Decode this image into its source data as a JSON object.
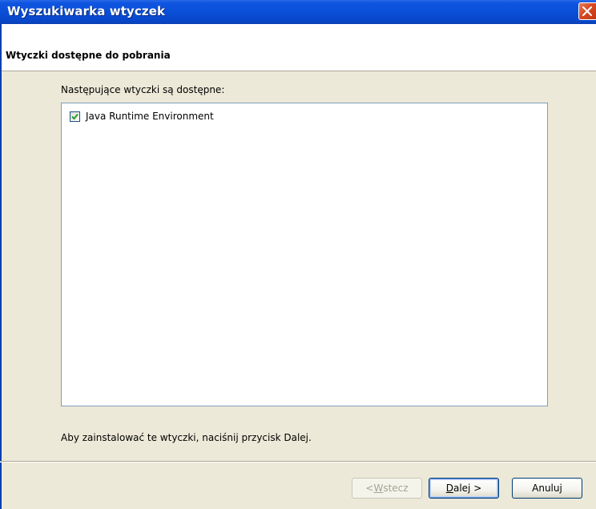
{
  "window": {
    "title": "Wyszukiwarka wtyczek"
  },
  "header": {
    "title": "Wtyczki dostępne do pobrania"
  },
  "content": {
    "intro_label": "Następujące wtyczki są dostępne:",
    "plugins": [
      {
        "label": "Java Runtime Environment",
        "checked": true
      }
    ],
    "footer_text": "Aby zainstalować te wtyczki, naciśnij przycisk Dalej."
  },
  "buttons": {
    "back": {
      "mnemonic": "W",
      "rest": "stecz",
      "prefix": "< ",
      "enabled": false
    },
    "next": {
      "mnemonic": "D",
      "rest": "alej >",
      "enabled": true,
      "default": true
    },
    "cancel": {
      "label": "Anuluj",
      "enabled": true
    }
  },
  "colors": {
    "titlebar": "#0a4fd8",
    "close_button": "#d84a24",
    "dialog_bg": "#ece9d8",
    "listbox_border": "#7f9db9"
  },
  "icons": {
    "close": "close-icon",
    "checkbox": "checkmark-icon"
  }
}
